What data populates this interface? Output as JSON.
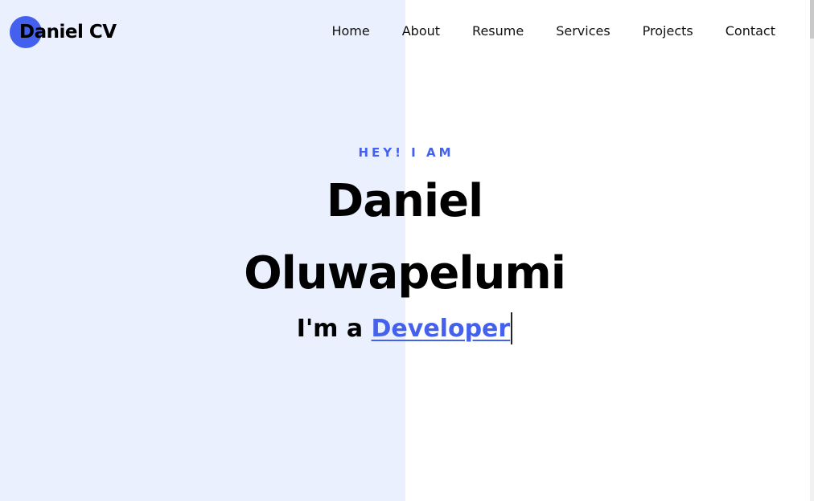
{
  "colors": {
    "accent": "#4361ee",
    "left_panel_bg": "#ebf0ff",
    "page_bg": "#ffffff"
  },
  "header": {
    "logo": {
      "text": "Daniel CV"
    },
    "nav": [
      {
        "label": "Home"
      },
      {
        "label": "About"
      },
      {
        "label": "Resume"
      },
      {
        "label": "Services"
      },
      {
        "label": "Projects"
      },
      {
        "label": "Contact"
      }
    ]
  },
  "hero": {
    "eyebrow": "HEY! I AM",
    "name": "Daniel Oluwapelumi",
    "role_prefix": "I'm a ",
    "role_typed": "Developer"
  }
}
